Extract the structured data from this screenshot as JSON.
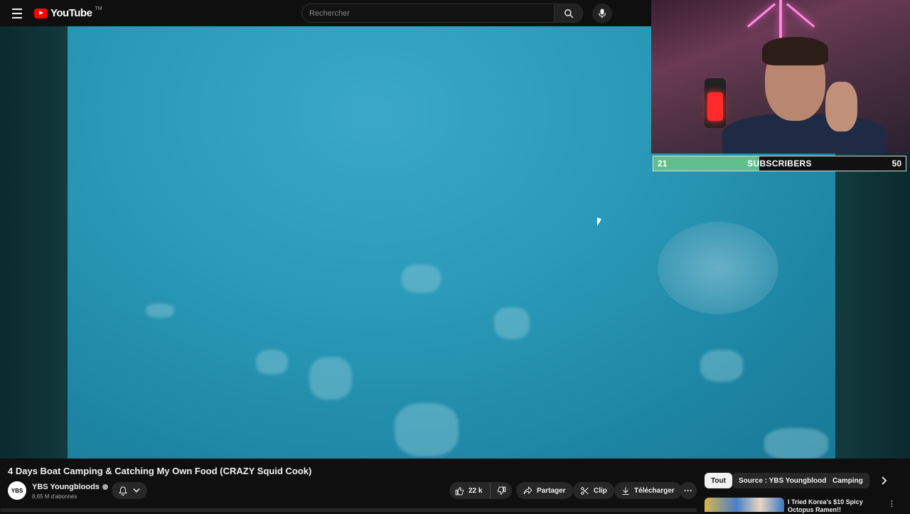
{
  "header": {
    "logo_text": "YouTube",
    "logo_tm": "TM",
    "search_placeholder": "Rechercher"
  },
  "overlay": {
    "current": "21",
    "label": "SUBSCRIBERS",
    "goal": "50",
    "progress": 0.42
  },
  "video": {
    "title": "4 Days Boat Camping & Catching My Own Food (CRAZY Squid Cook)"
  },
  "channel": {
    "avatar_text": "YBS",
    "name": "YBS Youngbloods",
    "subscribers": "8,65 M d'abonnés"
  },
  "actions": {
    "likes": "22 k",
    "share": "Partager",
    "clip": "Clip",
    "download": "Télécharger",
    "more": "···"
  },
  "chips": {
    "items": [
      "Tout",
      "Source : YBS Youngbloods",
      "Camping"
    ],
    "active_index": 0
  },
  "recommendation": {
    "title": "I Tried Korea's $10 Spicy Octopus Ramen!!"
  },
  "colors": {
    "background": "#0f0f0f",
    "brand_red": "#ff0000",
    "progress_green": "#5fbf8c",
    "water": "#2a9ab8"
  }
}
